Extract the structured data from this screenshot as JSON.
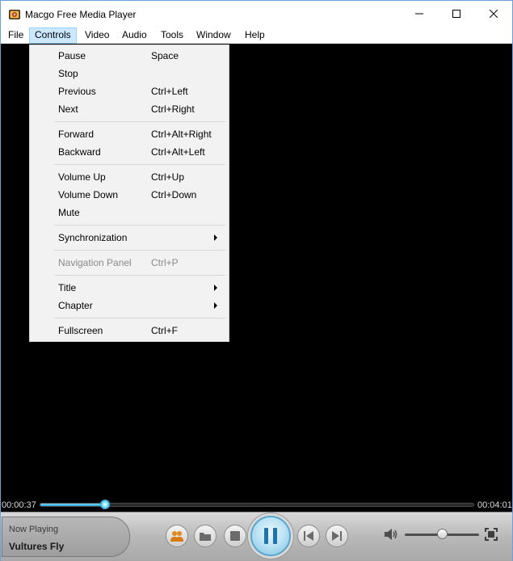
{
  "window": {
    "title": "Macgo Free Media Player",
    "icon": "film-reel-icon"
  },
  "menubar": {
    "items": [
      {
        "label": "File",
        "active": false
      },
      {
        "label": "Controls",
        "active": true
      },
      {
        "label": "Video",
        "active": false
      },
      {
        "label": "Audio",
        "active": false
      },
      {
        "label": "Tools",
        "active": false
      },
      {
        "label": "Window",
        "active": false
      },
      {
        "label": "Help",
        "active": false
      }
    ]
  },
  "controls_menu": {
    "items": [
      {
        "label": "Pause",
        "shortcut": "Space"
      },
      {
        "label": "Stop",
        "shortcut": ""
      },
      {
        "label": "Previous",
        "shortcut": "Ctrl+Left"
      },
      {
        "label": "Next",
        "shortcut": "Ctrl+Right"
      },
      {
        "label": "Forward",
        "shortcut": "Ctrl+Alt+Right"
      },
      {
        "label": "Backward",
        "shortcut": "Ctrl+Alt+Left"
      },
      {
        "label": "Volume Up",
        "shortcut": "Ctrl+Up"
      },
      {
        "label": "Volume Down",
        "shortcut": "Ctrl+Down"
      },
      {
        "label": "Mute",
        "shortcut": ""
      },
      {
        "label": "Synchronization",
        "shortcut": "",
        "submenu": true
      },
      {
        "label": "Navigation Panel",
        "shortcut": "Ctrl+P",
        "disabled": true
      },
      {
        "label": "Title",
        "shortcut": "",
        "submenu": true
      },
      {
        "label": "Chapter",
        "shortcut": "",
        "submenu": true
      },
      {
        "label": "Fullscreen",
        "shortcut": "Ctrl+F"
      }
    ]
  },
  "playback": {
    "current_time": "00:00:37",
    "total_time": "00:04:01",
    "progress": 0.15,
    "volume": 0.5,
    "now_playing_label": "Now Playing",
    "track_title": "Vultures Fly",
    "state": "playing"
  },
  "colors": {
    "accent": "#2aa4d8",
    "menu_highlight": "#cce8ff",
    "video_bg": "#000000"
  }
}
